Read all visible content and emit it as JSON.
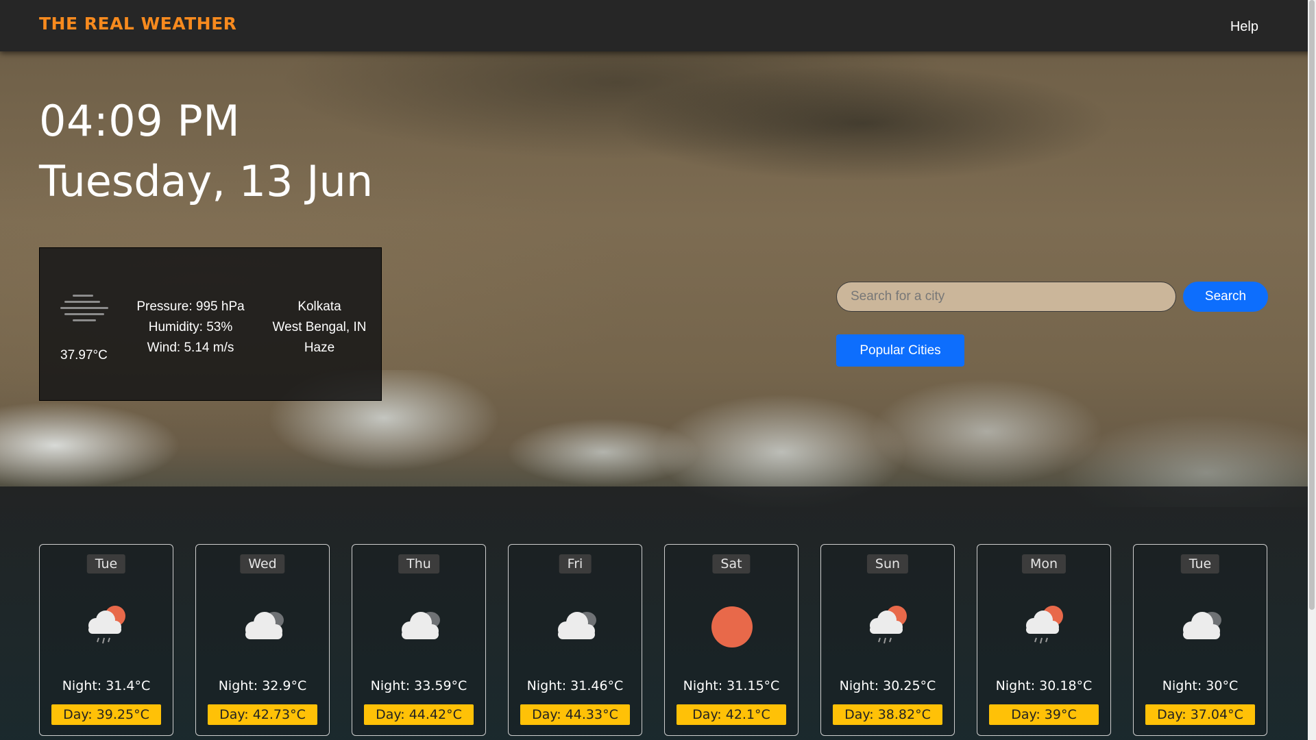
{
  "app": {
    "title": "THE REAL WEATHER",
    "help_label": "Help"
  },
  "clock": {
    "time": "04:09 PM",
    "date": "Tuesday, 13 Jun"
  },
  "current": {
    "icon": "haze-icon",
    "temperature": "37.97°C",
    "pressure": "Pressure: 995 hPa",
    "humidity": "Humidity: 53%",
    "wind": "Wind: 5.14 m/s",
    "city": "Kolkata",
    "region": "West Bengal, IN",
    "condition": "Haze"
  },
  "search": {
    "placeholder": "Search for a city",
    "button_label": "Search",
    "popular_label": "Popular Cities"
  },
  "colors": {
    "brand": "#f78a1e",
    "primary_button": "#0d6efd",
    "day_badge": "#ffc107",
    "sun": "#e8694a"
  },
  "forecast": [
    {
      "day": "Tue",
      "icon": "rain-cloud-sun-icon",
      "night": "Night: 31.4°C",
      "day_temp": "Day: 39.25°C"
    },
    {
      "day": "Wed",
      "icon": "cloud-icon",
      "night": "Night: 32.9°C",
      "day_temp": "Day: 42.73°C"
    },
    {
      "day": "Thu",
      "icon": "cloud-icon",
      "night": "Night: 33.59°C",
      "day_temp": "Day: 44.42°C"
    },
    {
      "day": "Fri",
      "icon": "cloud-icon",
      "night": "Night: 31.46°C",
      "day_temp": "Day: 44.33°C"
    },
    {
      "day": "Sat",
      "icon": "sun-icon",
      "night": "Night: 31.15°C",
      "day_temp": "Day: 42.1°C"
    },
    {
      "day": "Sun",
      "icon": "rain-cloud-sun-icon",
      "night": "Night: 30.25°C",
      "day_temp": "Day: 38.82°C"
    },
    {
      "day": "Mon",
      "icon": "rain-cloud-sun-icon",
      "night": "Night: 30.18°C",
      "day_temp": "Day: 39°C"
    },
    {
      "day": "Tue",
      "icon": "cloud-icon",
      "night": "Night: 30°C",
      "day_temp": "Day: 37.04°C"
    }
  ]
}
